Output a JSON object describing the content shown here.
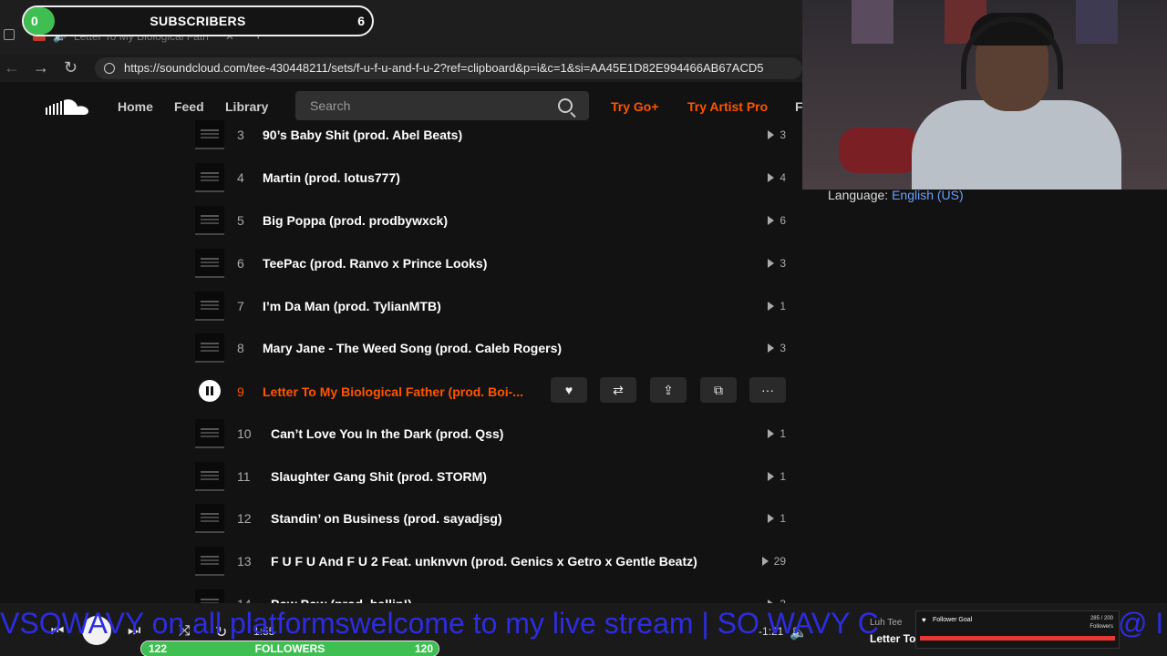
{
  "browser": {
    "tab_title": "Letter To My Biological Fath",
    "tab_close": "✕",
    "new_tab": "+",
    "url": "https://soundcloud.com/tee-430448211/sets/f-u-f-u-and-f-u-2?ref=clipboard&p=i&c=1&si=AA45E1D82E994466AB67ACD5"
  },
  "header": {
    "nav": [
      "Home",
      "Feed",
      "Library"
    ],
    "search_placeholder": "Search",
    "try_go": "Try Go+",
    "try_artist": "Try Artist Pro",
    "overflow_label": "F"
  },
  "tracks": [
    {
      "num": "3",
      "title": "90’s Baby Shit (prod. Abel Beats)",
      "plays": "3"
    },
    {
      "num": "4",
      "title": "Martin (prod. lotus777)",
      "plays": "4"
    },
    {
      "num": "5",
      "title": "Big Poppa (prod. prodbywxck)",
      "plays": "6"
    },
    {
      "num": "6",
      "title": "TeePac (prod. Ranvo x Prince Looks)",
      "plays": "3"
    },
    {
      "num": "7",
      "title": "I’m Da Man (prod. TylianMTB)",
      "plays": "1"
    },
    {
      "num": "8",
      "title": "Mary Jane - The Weed Song (prod. Caleb Rogers)",
      "plays": "3"
    },
    {
      "num": "9",
      "title": "Letter To My Biological Father (prod. Boi-...",
      "plays": ""
    },
    {
      "num": "10",
      "title": "Can’t Love You In the Dark (prod. Qss)",
      "plays": "1"
    },
    {
      "num": "11",
      "title": "Slaughter Gang Shit (prod. STORM)",
      "plays": "1"
    },
    {
      "num": "12",
      "title": "Standin’ on Business (prod. sayadjsg)",
      "plays": "1"
    },
    {
      "num": "13",
      "title": "F U F U And F U 2 Feat. unknvvn (prod. Genics x Getro x Gentle Beatz)",
      "plays": "29"
    },
    {
      "num": "14",
      "title": "Pow Pow (prod. ballin!)",
      "plays": "3"
    }
  ],
  "active_actions": {
    "like": "♥",
    "repost": "⇄",
    "share": "⇪",
    "copy": "⧉",
    "more": "···"
  },
  "language": {
    "label": "Language:",
    "value": "English (US)"
  },
  "subscribers": {
    "start": "0",
    "title": "SUBSCRIBERS",
    "goal": "6",
    "progress": 0.09
  },
  "ticker": "VSOWAVY on all platformswelcome to my live stream | SO WAVY C",
  "ticker_tail": "@ I",
  "player": {
    "elapsed": "1:55",
    "remaining": "-1:21",
    "artist": "Luh Tee",
    "title": "Letter To"
  },
  "followers_goal": {
    "current": "122",
    "label": "FOLLOWERS",
    "target": "120",
    "progress": 1.0
  },
  "follower_widget": {
    "title": "Follower Goal",
    "count": "285 / 200",
    "unit": "Followers"
  },
  "colors": {
    "accent": "#ff5500",
    "goal_green": "#3fbf52",
    "ticker_blue": "#2d2ddf"
  }
}
